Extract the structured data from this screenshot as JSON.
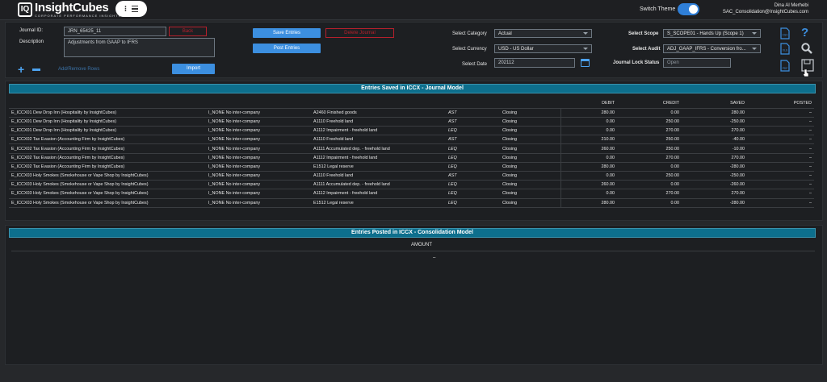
{
  "header": {
    "logo_mark": "IQ",
    "logo_name": "InsightCubes",
    "logo_tagline": "CORPORATE PERFORMANCE INSIGHTS",
    "menu_dots": "⁝",
    "switch_theme_label": "Switch Theme",
    "switch_theme_on": true,
    "user_name": "Dina Al Merhebi",
    "user_email": "SAC_Consolidation@InsightCubes.com"
  },
  "form": {
    "journal_id_label": "Journal ID:",
    "journal_id_value": "JRN_65425_11",
    "back_button": "Back",
    "description_label": "Description",
    "description_value": "Adjustments from GAAP to IFRS",
    "save_entries_button": "Save Entries",
    "delete_journal_button": "Delete Journal",
    "post_entries_button": "Post Entries",
    "add_remove_rows": "Add/Remove Rows",
    "import_button": "Import",
    "category_label": "Select Category",
    "category_value": "Actual",
    "currency_label": "Select Currency",
    "currency_value": "USD - US Dollar",
    "date_label": "Select Date",
    "date_value": "202112",
    "scope_label": "Select Scope",
    "scope_value": "S_SCOPE01 - Hands Up (Scope 1)",
    "audit_label": "Select Audit",
    "audit_value": "ADJ_GAAP_IFRS - Conversion fro...",
    "lock_status_label": "Journal Lock Status",
    "lock_status_value": "Open"
  },
  "icons": {
    "csv": "CSV",
    "xls": "XLS",
    "pdf": "PDF",
    "help": "?"
  },
  "journal_section": {
    "title": "Entries Saved in ICCX - Journal Model",
    "columns": [
      "DEBIT",
      "CREDIT",
      "SAVED",
      "POSTED"
    ],
    "rows": [
      [
        "E_ICCX01 Dew Drop Inn (Hospitality by InsightCubes)",
        "I_NONE No inter-company",
        "A2460 Finished goods",
        "AST",
        "Closing",
        "280.00",
        "0.00",
        "280.00",
        "–"
      ],
      [
        "E_ICCX01 Dew Drop Inn (Hospitality by InsightCubes)",
        "I_NONE No inter-company",
        "A1110 Freehold land",
        "AST",
        "Closing",
        "0.00",
        "250.00",
        "-250.00",
        "–"
      ],
      [
        "E_ICCX01 Dew Drop Inn (Hospitality by InsightCubes)",
        "I_NONE No inter-company",
        "A1112 Impairment - freehold land",
        "LEQ",
        "Closing",
        "0.00",
        "270.00",
        "270.00",
        "–"
      ],
      [
        "E_ICCX02 Tax Evasion (Accounting Firm by InsightCubes)",
        "I_NONE No inter-company",
        "A1110 Freehold land",
        "AST",
        "Closing",
        "210.00",
        "250.00",
        "-40.00",
        "–"
      ],
      [
        "E_ICCX02 Tax Evasion (Accounting Firm by InsightCubes)",
        "I_NONE No inter-company",
        "A1111 Accumulated dep. - freehold land",
        "LEQ",
        "Closing",
        "260.00",
        "250.00",
        "-10.00",
        "–"
      ],
      [
        "E_ICCX02 Tax Evasion (Accounting Firm by InsightCubes)",
        "I_NONE No inter-company",
        "A1112 Impairment - freehold land",
        "LEQ",
        "Closing",
        "0.00",
        "270.00",
        "270.00",
        "–"
      ],
      [
        "E_ICCX02 Tax Evasion (Accounting Firm by InsightCubes)",
        "I_NONE No inter-company",
        "E1512 Legal reserve",
        "LEQ",
        "Closing",
        "280.00",
        "0.00",
        "-280.00",
        "–"
      ],
      [
        "E_ICCX03 Holy Smokes (Smokehouse or Vape Shop by InsightCubes)",
        "I_NONE No inter-company",
        "A1110 Freehold land",
        "AST",
        "Closing",
        "0.00",
        "250.00",
        "-250.00",
        "–"
      ],
      [
        "E_ICCX03 Holy Smokes (Smokehouse or Vape Shop by InsightCubes)",
        "I_NONE No inter-company",
        "A1111 Accumulated dep. - freehold land",
        "LEQ",
        "Closing",
        "260.00",
        "0.00",
        "-260.00",
        "–"
      ],
      [
        "E_ICCX03 Holy Smokes (Smokehouse or Vape Shop by InsightCubes)",
        "I_NONE No inter-company",
        "A1112 Impairment - freehold land",
        "LEQ",
        "Closing",
        "0.00",
        "270.00",
        "270.00",
        "–"
      ],
      [
        "E_ICCX03 Holy Smokes (Smokehouse or Vape Shop by InsightCubes)",
        "I_NONE No inter-company",
        "E1512 Legal reserve",
        "LEQ",
        "Closing",
        "280.00",
        "0.00",
        "-280.00",
        "–"
      ]
    ]
  },
  "consolidation_section": {
    "title": "Entries Posted in ICCX - Consolidation Model",
    "amount_header": "AMOUNT",
    "amount_value": "–"
  },
  "colors": {
    "accent": "#3c8fe0",
    "section_header": "#0d6f8d",
    "danger": "#b5202c"
  }
}
